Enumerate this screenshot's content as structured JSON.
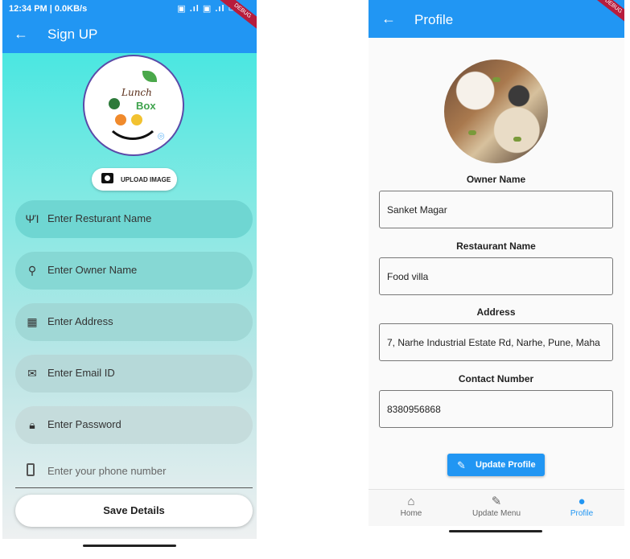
{
  "signup": {
    "status_time": "12:34 PM | 0.0KB/s",
    "title": "Sign UP",
    "debug_badge": "DEBUG",
    "upload_label": "UPLOAD IMAGE",
    "fields": [
      {
        "icon": "restaurant-icon",
        "placeholder": "Enter Resturant Name"
      },
      {
        "icon": "person-icon",
        "placeholder": "Enter Owner Name"
      },
      {
        "icon": "building-icon",
        "placeholder": "Enter Address"
      },
      {
        "icon": "email-icon",
        "placeholder": "Enter Email ID"
      },
      {
        "icon": "lock-icon",
        "placeholder": "Enter Password"
      }
    ],
    "phone_placeholder": "Enter your phone number",
    "save_label": "Save Details",
    "colors": {
      "appbar": "#2196f3",
      "gradient_top": "#36e6e0",
      "gradient_bottom": "#eef0f1"
    }
  },
  "profile": {
    "title": "Profile",
    "debug_badge": "DEBUG",
    "owner_label": "Owner Name",
    "owner_value": "Sanket Magar",
    "restaurant_label": "Restaurant Name",
    "restaurant_value": "Food villa",
    "address_label": "Address",
    "address_value": "7, Narhe Industrial Estate Rd, Narhe, Pune, Maha",
    "contact_label": "Contact Number",
    "contact_value": "8380956868",
    "update_label": "Update Profile",
    "nav": [
      {
        "label": "Home",
        "icon": "home-icon",
        "active": false
      },
      {
        "label": "Update Menu",
        "icon": "pencil-icon",
        "active": false
      },
      {
        "label": "Profile",
        "icon": "person-icon",
        "active": true
      }
    ],
    "colors": {
      "accent": "#2196f3"
    }
  }
}
